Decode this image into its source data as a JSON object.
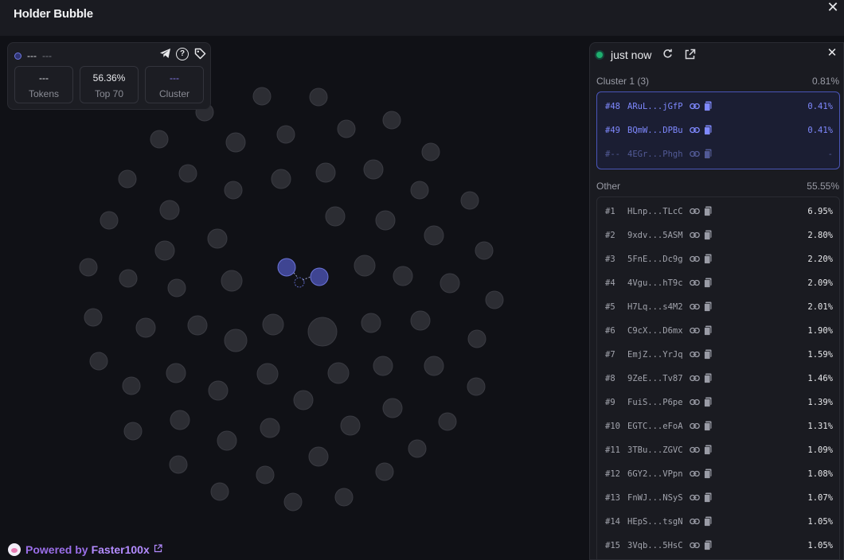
{
  "window": {
    "title": "Holder Bubble",
    "close_label": "✕"
  },
  "stats": {
    "header_left": "---",
    "header_right": "---",
    "items": [
      {
        "value": "---",
        "label": "Tokens"
      },
      {
        "value": "56.36%",
        "label": "Top 70"
      },
      {
        "value": "---",
        "label": "Cluster"
      }
    ]
  },
  "panel": {
    "status": "just now",
    "cluster_section": {
      "title": "Cluster 1 (3)",
      "percent": "0.81%"
    },
    "cluster_rows": [
      {
        "rank": "#48",
        "address": "ARuL...jGfP",
        "percent": "0.41%",
        "style": "active"
      },
      {
        "rank": "#49",
        "address": "BQmW...DPBu",
        "percent": "0.41%",
        "style": "active"
      },
      {
        "rank": "#--",
        "address": "4EGr...Phgh",
        "percent": "-",
        "style": "dim"
      }
    ],
    "other_section": {
      "title": "Other",
      "percent": "55.55%"
    },
    "other_rows": [
      {
        "rank": "#1",
        "address": "HLnp...TLcC",
        "percent": "6.95%"
      },
      {
        "rank": "#2",
        "address": "9xdv...5ASM",
        "percent": "2.80%"
      },
      {
        "rank": "#3",
        "address": "5FnE...Dc9g",
        "percent": "2.20%"
      },
      {
        "rank": "#4",
        "address": "4Vgu...hT9c",
        "percent": "2.09%"
      },
      {
        "rank": "#5",
        "address": "H7Lq...s4M2",
        "percent": "2.01%"
      },
      {
        "rank": "#6",
        "address": "C9cX...D6mx",
        "percent": "1.90%"
      },
      {
        "rank": "#7",
        "address": "EmjZ...YrJq",
        "percent": "1.59%"
      },
      {
        "rank": "#8",
        "address": "9ZeE...Tv87",
        "percent": "1.46%"
      },
      {
        "rank": "#9",
        "address": "FuiS...P6pe",
        "percent": "1.39%"
      },
      {
        "rank": "#10",
        "address": "EGTC...eFoA",
        "percent": "1.31%"
      },
      {
        "rank": "#11",
        "address": "3TBu...ZGVC",
        "percent": "1.09%"
      },
      {
        "rank": "#12",
        "address": "6GY2...VPpn",
        "percent": "1.08%"
      },
      {
        "rank": "#13",
        "address": "FnWJ...NSyS",
        "percent": "1.07%"
      },
      {
        "rank": "#14",
        "address": "HEpS...tsgN",
        "percent": "1.05%"
      },
      {
        "rank": "#15",
        "address": "3Vqb...5HsC",
        "percent": "1.05%"
      }
    ]
  },
  "footer": {
    "powered_prefix": "Powered by",
    "brand": "Faster100x"
  },
  "icons": [
    "telegram-icon",
    "help-icon",
    "tag-icon",
    "refresh-icon",
    "external-link-icon",
    "close-icon",
    "link-icon",
    "copy-icon"
  ],
  "colors": {
    "accent_blue": "#7f89ff",
    "live_green": "#1faf6e",
    "brand_purple": "#b38bff",
    "bubble": "#2c2d33"
  }
}
